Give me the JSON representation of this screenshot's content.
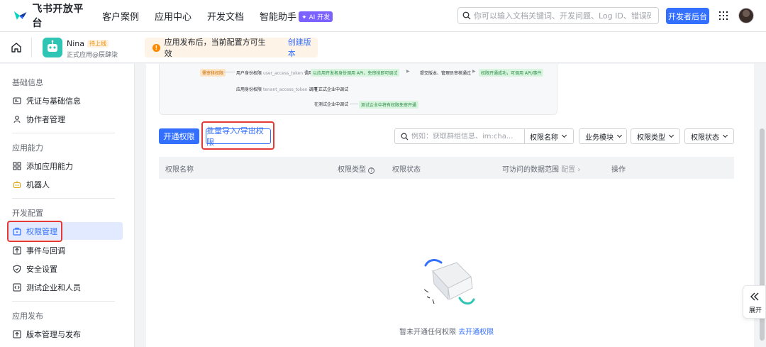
{
  "brand": {
    "name": "飞书开放平台"
  },
  "nav": {
    "links": [
      "客户案例",
      "应用中心",
      "开发文档",
      "智能助手"
    ],
    "ai_badge": "✦ AI 开发"
  },
  "search": {
    "placeholder": "你可以输入文档关键词、开发问题、Log ID、错误码"
  },
  "dev_console": "开发者后台",
  "app": {
    "name": "Nina",
    "status": "待上线",
    "subtitle": "正式应用@辰肆柒"
  },
  "notice": {
    "text": "应用发布后，当前配置方可生效",
    "link": "创建版本"
  },
  "sidebar": {
    "groups": [
      {
        "title": "基础信息",
        "items": [
          "凭证与基础信息",
          "协作者管理"
        ]
      },
      {
        "title": "应用能力",
        "items": [
          "添加应用能力",
          "机器人"
        ]
      },
      {
        "title": "开发配置",
        "items": [
          "权限管理",
          "事件与回调",
          "安全设置",
          "测试企业和人员"
        ]
      },
      {
        "title": "应用发布",
        "items": [
          "版本管理与发布"
        ]
      }
    ],
    "active_item": "权限管理"
  },
  "flow": {
    "tag_review": "需审核权限",
    "user_perm": "用户身份权限",
    "user_token": "user_access_token",
    "user_call": "调用",
    "tenant_perm": "应用身份权限",
    "tenant_token": "tenant_access_token",
    "tenant_call": "调用",
    "step_user_api": "以应用开发者身份调用 API，免审核即可调试",
    "step_submit": "提交版本、管理员审核通过",
    "step_success": "权限开通成功，可调用 API/事件",
    "step_prod": "在正式企业中调试",
    "step_test": "在测试企业中调试",
    "step_test_all": "测试企业中将有权限免审开通"
  },
  "toolbar": {
    "enable_btn": "开通权限",
    "import_export_btn": "批量导入/导出权限",
    "filter_placeholder": "例如：获取群组信息、im:cha...",
    "filter_field": "权限名称",
    "filters": [
      "业务模块",
      "权限类型",
      "权限状态"
    ]
  },
  "table": {
    "headers": [
      "权限名称",
      "权限类型",
      "权限状态",
      "可访问的数据范围",
      "配置",
      "操作"
    ]
  },
  "empty": {
    "text": "暂未开通任何权限",
    "link": "去开通权限"
  },
  "expand": {
    "label": "展开"
  },
  "colors": {
    "accent": "#3370ff",
    "highlight": "#e53935",
    "warning": "#ff8800"
  }
}
